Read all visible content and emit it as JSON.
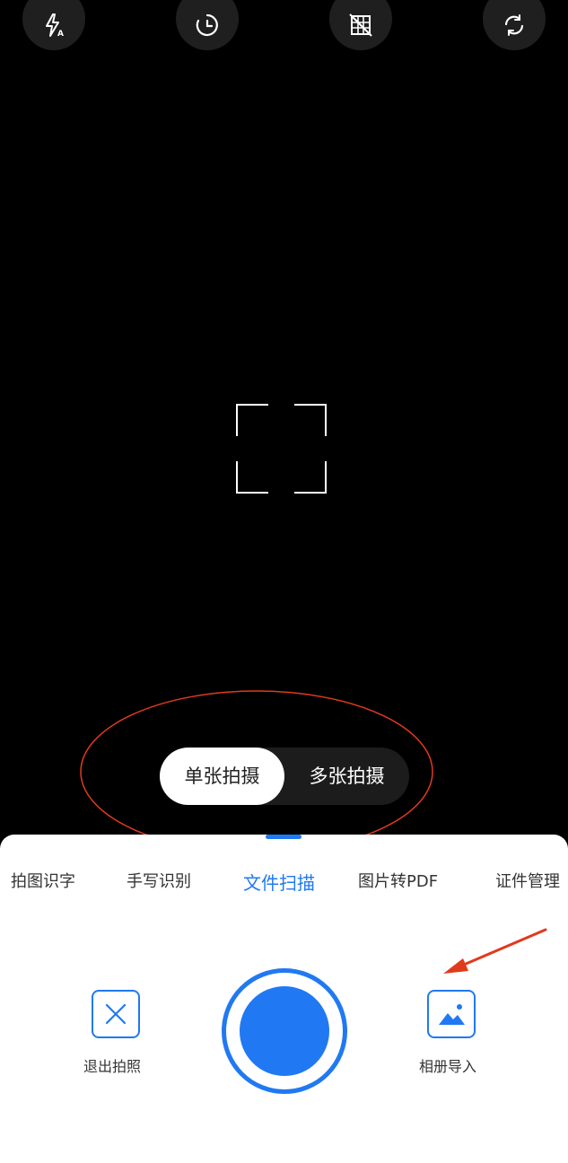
{
  "top_toolbar": {
    "icons": [
      "flash-auto-icon",
      "timer-icon",
      "grid-off-icon",
      "rotate-icon"
    ]
  },
  "mode_toggle": {
    "single": "单张拍摄",
    "multi": "多张拍摄",
    "selected": "单张拍摄"
  },
  "tabs": [
    {
      "label": "拍图识字"
    },
    {
      "label": "手写识别"
    },
    {
      "label": "文件扫描"
    },
    {
      "label": "图片转PDF"
    },
    {
      "label": "证件管理"
    }
  ],
  "active_tab": "文件扫描",
  "actions": {
    "exit_label": "退出拍照",
    "album_label": "相册导入"
  },
  "colors": {
    "accent": "#2079f2",
    "annotation": "#e03a1e"
  }
}
